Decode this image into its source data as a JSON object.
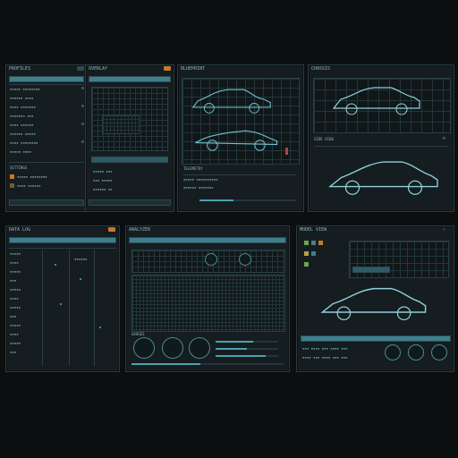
{
  "panels": {
    "p1": {
      "title": "PROFILES",
      "section": "SETTINGS"
    },
    "p2": {
      "title": "OVERLAY"
    },
    "p3": {
      "title": "BLUEPRINT",
      "section": "TELEMETRY"
    },
    "p4": {
      "title": "CHASSIS",
      "section": "SIDE VIEW"
    },
    "p5": {
      "title": "DATA LOG"
    },
    "p6": {
      "title": "ANALYZER",
      "section": "GAUGES"
    },
    "p7": {
      "title": "MODEL VIEW"
    }
  },
  "colors": {
    "accent": "#4aa3b1",
    "orange": "#c47a2a",
    "green": "#6aa84f",
    "red": "#b24545",
    "background": "#0b0f10",
    "panel": "#151d20"
  },
  "icons": [
    "gear-icon",
    "close-icon",
    "grid-icon",
    "car-icon",
    "gauge-icon"
  ],
  "sliders": [
    0.35,
    0.6,
    0.5,
    0.8,
    0.45
  ]
}
